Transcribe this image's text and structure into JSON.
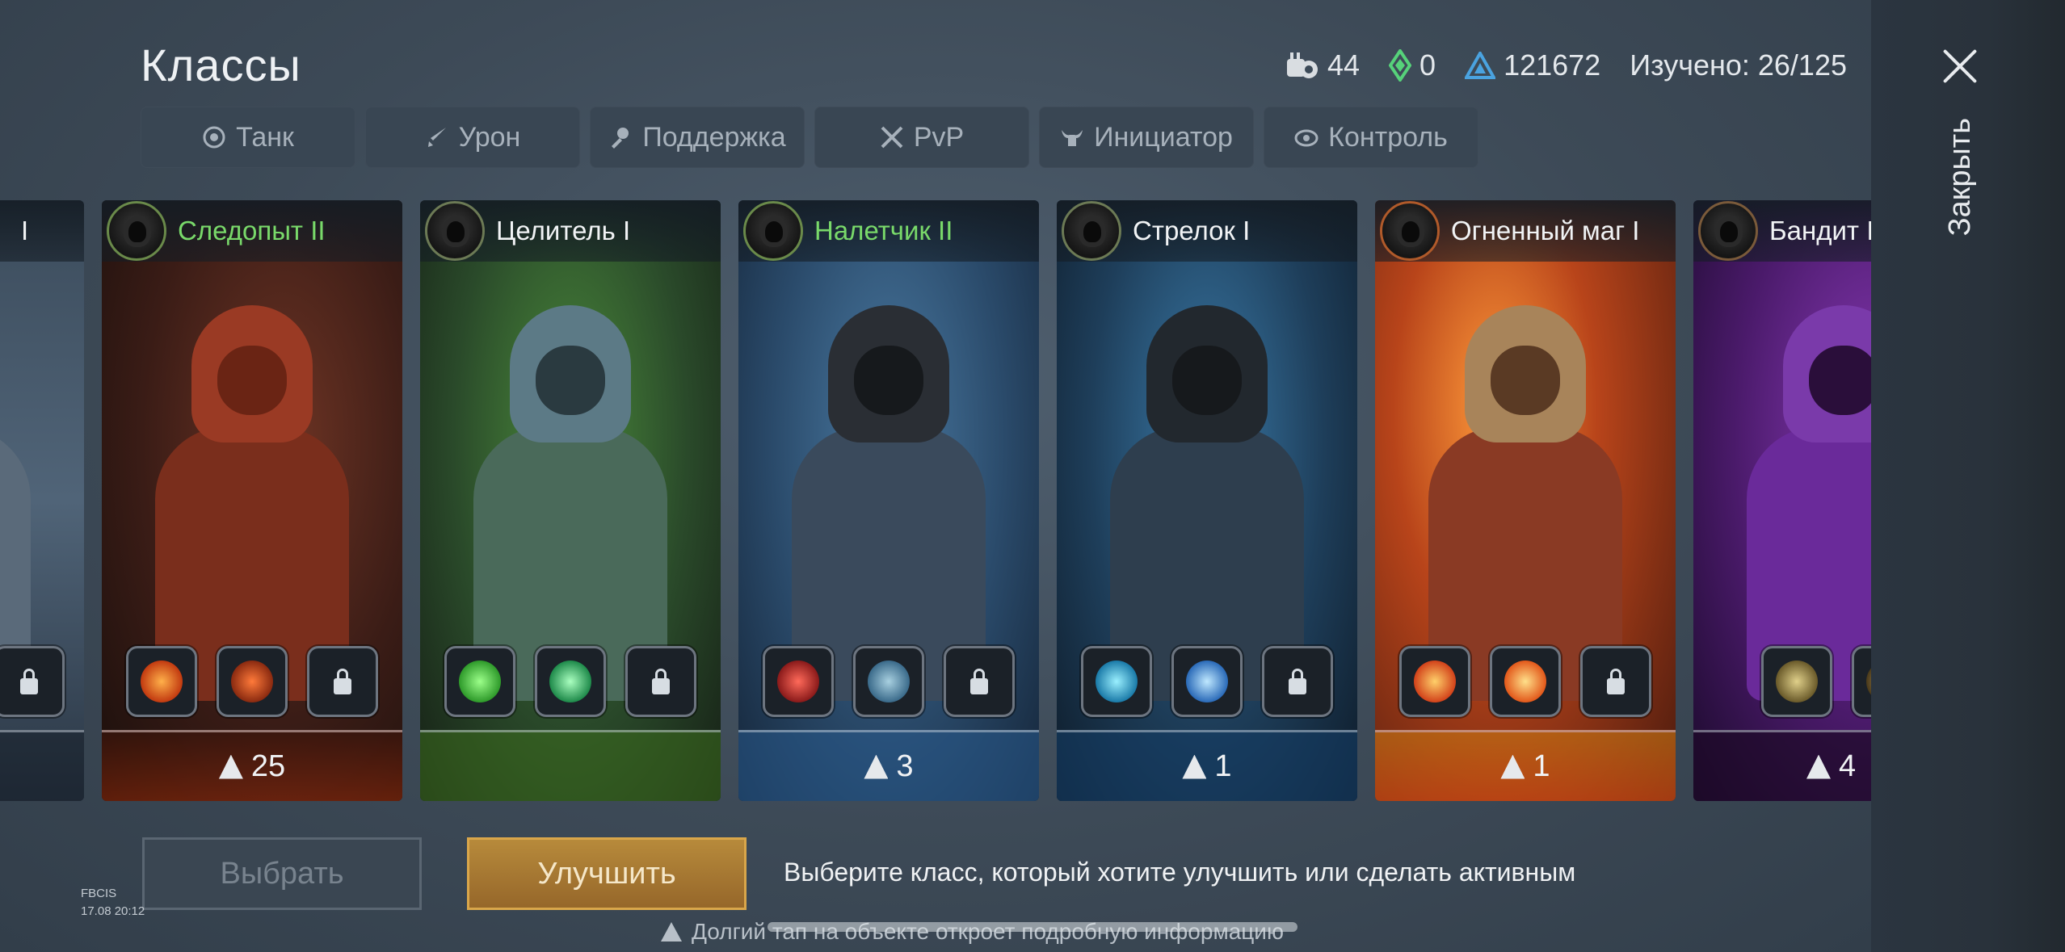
{
  "header": {
    "title": "Классы",
    "stats": {
      "scrolls": "44",
      "green_currency": "0",
      "blue_currency": "121672",
      "studied": "Изучено: 26/125"
    }
  },
  "close": {
    "label": "Закрыть"
  },
  "tabs": [
    {
      "label": "Танк",
      "icon": "shield-icon"
    },
    {
      "label": "Урон",
      "icon": "dagger-icon"
    },
    {
      "label": "Поддержка",
      "icon": "support-icon"
    },
    {
      "label": "PvP",
      "icon": "crossed-swords-icon"
    },
    {
      "label": "Инициатор",
      "icon": "bull-icon"
    },
    {
      "label": "Контроль",
      "icon": "eye-icon"
    }
  ],
  "cards": [
    {
      "name": "I",
      "name_color": "white",
      "count": "",
      "palette": "#5a6a7a",
      "skills": [
        "locked"
      ]
    },
    {
      "name": "Следопыт II",
      "name_color": "green",
      "count": "25",
      "palette": "#8a3a22",
      "skills": [
        "arrow",
        "fire",
        "locked"
      ]
    },
    {
      "name": "Целитель I",
      "name_color": "white",
      "count": "",
      "palette": "#3d7a34",
      "skills": [
        "heal",
        "orb",
        "locked"
      ]
    },
    {
      "name": "Налетчик II",
      "name_color": "green",
      "count": "3",
      "palette": "#3b6c93",
      "skills": [
        "strike",
        "shield",
        "locked"
      ]
    },
    {
      "name": "Стрелок I",
      "name_color": "white",
      "count": "1",
      "palette": "#2a5878",
      "skills": [
        "bolt",
        "lightning",
        "locked"
      ]
    },
    {
      "name": "Огненный маг I",
      "name_color": "white",
      "count": "1",
      "palette": "#b84a1f",
      "skills": [
        "fireball",
        "flame",
        "locked"
      ]
    },
    {
      "name": "Бандит I",
      "name_color": "white",
      "count": "4",
      "palette": "#6a2a9a",
      "skills": [
        "claws"
      ]
    }
  ],
  "buttons": {
    "select": "Выбрать",
    "upgrade": "Улучшить"
  },
  "hint": "Выберите класс, который хотите улучшить или сделать активным",
  "build": {
    "line1": "FBCIS",
    "line2": "17.08 20:12"
  },
  "bottom_hint": "Долгий тап на объекте откроет подробную информацию",
  "colors": {
    "accent_green": "#79d96a",
    "upgrade_gold": "#b78a3b",
    "background": "#3c4a58"
  }
}
